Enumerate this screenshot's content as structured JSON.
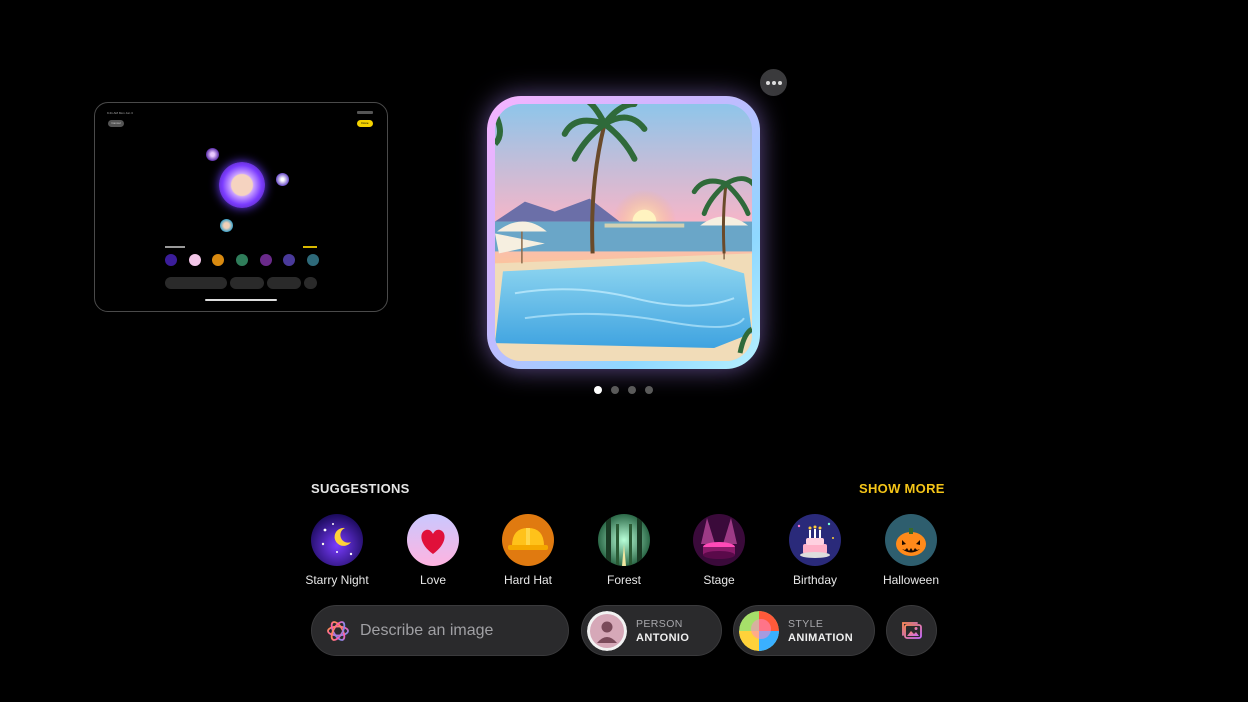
{
  "ipad_thumbnail": {
    "status_time": "9:41 AM  Mon Jun 3",
    "cancel_label": "Cancel",
    "done_label": "Done"
  },
  "preview": {
    "more_icon": "ellipsis-icon",
    "page_count": 4,
    "current_page": 1
  },
  "suggestions": {
    "title": "SUGGESTIONS",
    "show_more": "SHOW MORE",
    "items": [
      {
        "label": "Starry Night",
        "icon": "starry-night-icon"
      },
      {
        "label": "Love",
        "icon": "heart-icon"
      },
      {
        "label": "Hard Hat",
        "icon": "hard-hat-icon"
      },
      {
        "label": "Forest",
        "icon": "forest-icon"
      },
      {
        "label": "Stage",
        "icon": "stage-icon"
      },
      {
        "label": "Birthday",
        "icon": "birthday-cake-icon"
      },
      {
        "label": "Halloween",
        "icon": "pumpkin-icon"
      }
    ]
  },
  "bottom_bar": {
    "describe_placeholder": "Describe an image",
    "person": {
      "label": "PERSON",
      "value": "ANTONIO"
    },
    "style": {
      "label": "STYLE",
      "value": "ANIMATION"
    },
    "photo_icon": "photo-library-icon"
  },
  "colors": {
    "background": "#000000",
    "accent_yellow": "#f5c518",
    "chip_background": "#2a2a2c"
  }
}
